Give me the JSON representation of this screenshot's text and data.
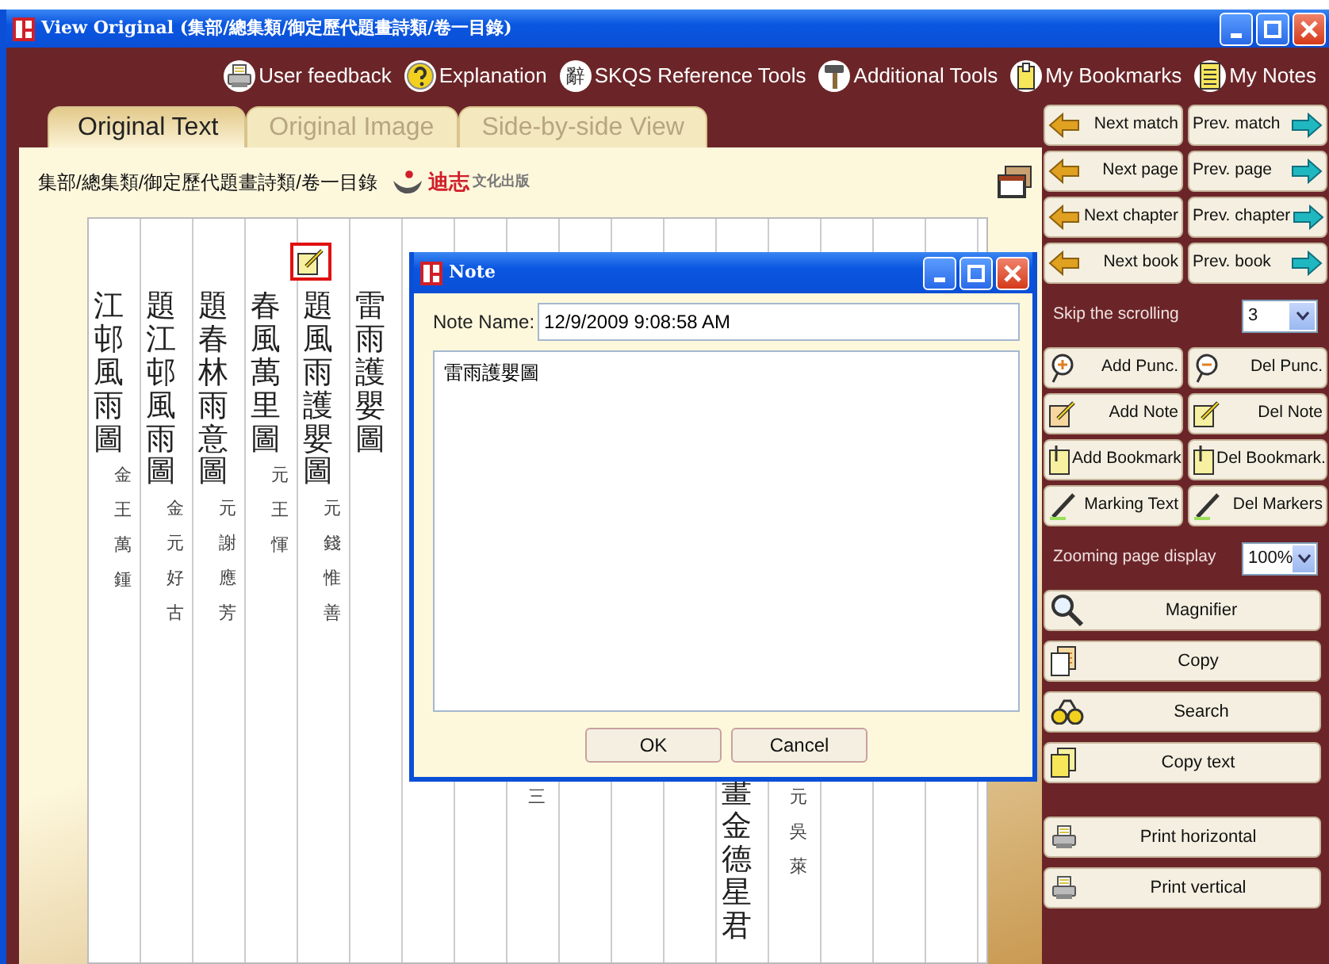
{
  "window": {
    "title": "View Original (集部/總集類/御定歷代題畫詩類/卷一目錄)"
  },
  "toolbar": [
    {
      "label": "User feedback"
    },
    {
      "label": "Explanation"
    },
    {
      "label": "SKQS Reference Tools",
      "glyph": "辭"
    },
    {
      "label": "Additional Tools"
    },
    {
      "label": "My Bookmarks"
    },
    {
      "label": "My Notes"
    }
  ],
  "tabs": [
    {
      "label": "Original Text",
      "selected": true
    },
    {
      "label": "Original Image",
      "selected": false
    },
    {
      "label": "Side-by-side View",
      "selected": false
    }
  ],
  "breadcrumb": "集部/總集類/御定歷代題畫詩類/卷一目錄",
  "logo": {
    "brand": "迪志",
    "sub": "文化出版"
  },
  "page": {
    "columns": [
      {
        "kind": "upper",
        "title": "江邨風雨圖",
        "author": "金王萬鍾"
      },
      {
        "kind": "upper",
        "title": "題江邨風雨圖",
        "author": "金元好古"
      },
      {
        "kind": "upper",
        "title": "題春林雨意圖",
        "author": "元謝應芳"
      },
      {
        "kind": "upper",
        "title": "春風萬里圖",
        "author": "元王惲"
      },
      {
        "kind": "upper",
        "title": "題風雨護嬰圖",
        "author": "元錢惟善",
        "marked": true
      },
      {
        "kind": "upper",
        "title": "雷雨護嬰圖"
      },
      {
        "kind": "empty"
      },
      {
        "kind": "empty"
      },
      {
        "kind": "lower",
        "author": "三"
      },
      {
        "kind": "empty"
      },
      {
        "kind": "empty"
      },
      {
        "kind": "empty"
      },
      {
        "kind": "lower",
        "title": "畫金德星君"
      },
      {
        "kind": "lower",
        "author": "元吳萊"
      },
      {
        "kind": "empty"
      },
      {
        "kind": "empty"
      },
      {
        "kind": "empty"
      }
    ]
  },
  "note_dialog": {
    "title": "Note",
    "name_label": "Note Name:",
    "name_value": "12/9/2009 9:08:58 AM",
    "body": "雷雨護嬰圖",
    "buttons": [
      "OK",
      "Cancel"
    ]
  },
  "sidebar": {
    "nav": [
      {
        "back": "Next match",
        "forward": "Prev. match"
      },
      {
        "back": "Next page",
        "forward": "Prev. page"
      },
      {
        "back": "Next chapter",
        "forward": "Prev. chapter"
      },
      {
        "back": "Next book",
        "forward": "Prev. book"
      }
    ],
    "skip": {
      "label": "Skip the scrolling",
      "value": "3"
    },
    "tools": [
      {
        "left": "Add Punc.",
        "right": "Del Punc."
      },
      {
        "left": "Add Note",
        "right": "Del Note"
      },
      {
        "left": "Add Bookmark",
        "right": "Del Bookmark."
      },
      {
        "left": "Marking Text",
        "right": "Del Markers"
      }
    ],
    "zoom": {
      "label": "Zooming page display",
      "value": "100%"
    },
    "actions": [
      "Magnifier",
      "Copy",
      "Search",
      "Copy text"
    ],
    "print": [
      "Print horizontal",
      "Print vertical"
    ]
  }
}
